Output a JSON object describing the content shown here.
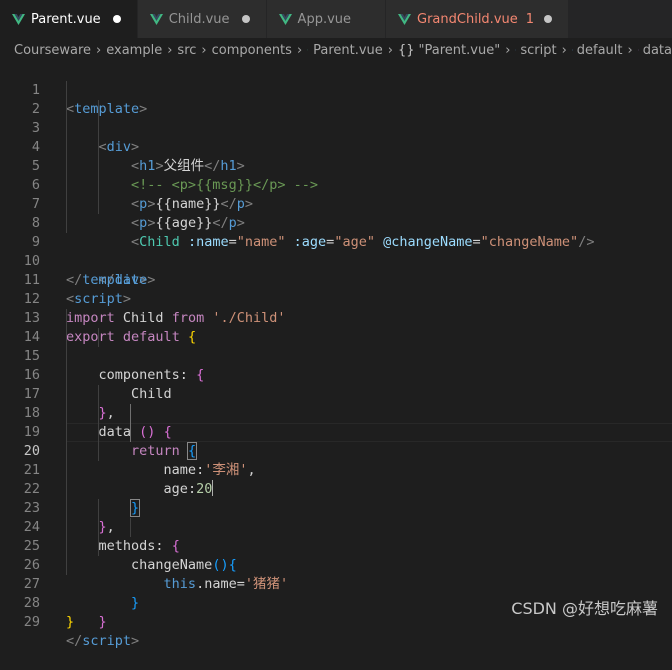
{
  "tabs": [
    {
      "label": "Parent.vue",
      "active": true,
      "modified": true,
      "error": false
    },
    {
      "label": "Child.vue",
      "active": false,
      "modified": true,
      "error": false
    },
    {
      "label": "App.vue",
      "active": false,
      "modified": false,
      "error": false
    },
    {
      "label": "GrandChild.vue",
      "active": false,
      "modified": true,
      "error": true,
      "error_count": "1"
    }
  ],
  "breadcrumb": {
    "items": [
      "Courseware",
      "example",
      "src",
      "components"
    ],
    "file": "Parent.vue",
    "module": "\"Parent.vue\"",
    "script": "script",
    "export": "default",
    "data": "data"
  },
  "lines": [
    {
      "n": "1"
    },
    {
      "n": "2"
    },
    {
      "n": "3"
    },
    {
      "n": "4"
    },
    {
      "n": "5"
    },
    {
      "n": "6"
    },
    {
      "n": "7"
    },
    {
      "n": "8"
    },
    {
      "n": "9"
    },
    {
      "n": "10"
    },
    {
      "n": "11"
    },
    {
      "n": "12"
    },
    {
      "n": "13"
    },
    {
      "n": "14"
    },
    {
      "n": "15"
    },
    {
      "n": "16"
    },
    {
      "n": "17"
    },
    {
      "n": "18"
    },
    {
      "n": "19"
    },
    {
      "n": "20"
    },
    {
      "n": "21"
    },
    {
      "n": "22"
    },
    {
      "n": "23"
    },
    {
      "n": "24"
    },
    {
      "n": "25"
    },
    {
      "n": "26"
    },
    {
      "n": "27"
    },
    {
      "n": "28"
    },
    {
      "n": "29"
    }
  ],
  "code": {
    "template": "template",
    "div": "div",
    "h1": "h1",
    "h1_text": "父组件",
    "comment": "<!-- <p>{{msg}}</p> -->",
    "p": "p",
    "name_interp": "{{name}}",
    "age_interp": "{{age}}",
    "child": "Child",
    "attr_name": ":name",
    "attr_name_val": "\"name\"",
    "attr_age": ":age",
    "attr_age_val": "\"age\"",
    "attr_event": "@changeName",
    "attr_event_val": "\"changeName\"",
    "script": "script",
    "import": "import",
    "from": "from",
    "import_path": "'./Child'",
    "export": "export",
    "default": "default",
    "components": "components",
    "data": "data",
    "return": "return",
    "prop_name": "name",
    "name_value": "'李湘'",
    "prop_age": "age",
    "age_value": "20",
    "methods": "methods",
    "changeName": "changeName",
    "this": "this",
    "new_name": "'猪猪'"
  },
  "watermark": "CSDN @好想吃麻薯",
  "colors": {
    "vue_green": "#41b883",
    "error": "#f48771",
    "keyword": "#c586c0",
    "tag": "#569cd6"
  }
}
